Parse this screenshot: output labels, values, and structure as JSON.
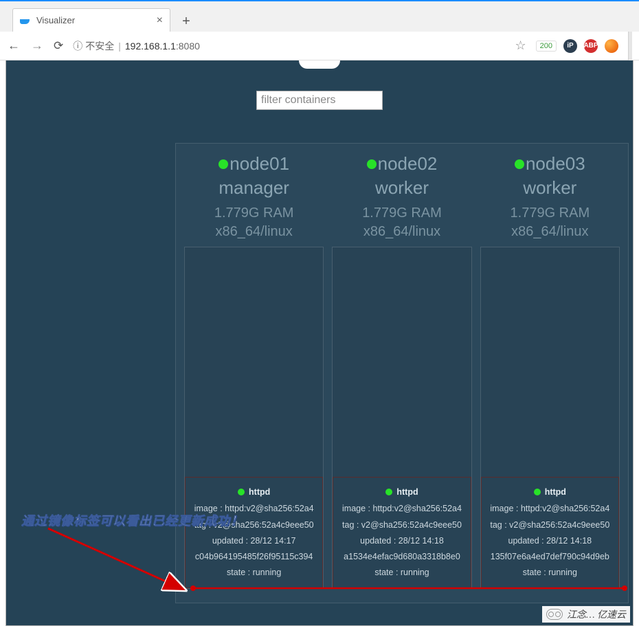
{
  "browser": {
    "tab": {
      "title": "Visualizer",
      "icon": "docker-whale-icon"
    },
    "nav": {
      "back_enabled": true,
      "forward_enabled": false
    },
    "address": {
      "insecure_label": "不安全",
      "host": "192.168.1.1",
      "port": "8080"
    },
    "ext_badge": "200"
  },
  "app": {
    "filter_placeholder": "filter containers",
    "nodes": [
      {
        "name": "node01",
        "role": "manager",
        "ram": "1.779G RAM",
        "arch": "x86_64/linux",
        "container": {
          "name": "httpd",
          "image": "image : httpd:v2@sha256:52a4",
          "tag": "tag : v2@sha256:52a4c9eee50",
          "updated": "updated : 28/12 14:17",
          "id": "c04b964195485f26f95115c394",
          "state": "state : running"
        }
      },
      {
        "name": "node02",
        "role": "worker",
        "ram": "1.779G RAM",
        "arch": "x86_64/linux",
        "container": {
          "name": "httpd",
          "image": "image : httpd:v2@sha256:52a4",
          "tag": "tag : v2@sha256:52a4c9eee50",
          "updated": "updated : 28/12 14:18",
          "id": "a1534e4efac9d680a3318b8e0",
          "state": "state : running"
        }
      },
      {
        "name": "node03",
        "role": "worker",
        "ram": "1.779G RAM",
        "arch": "x86_64/linux",
        "container": {
          "name": "httpd",
          "image": "image : httpd:v2@sha256:52a4",
          "tag": "tag : v2@sha256:52a4c9eee50",
          "updated": "updated : 28/12 14:18",
          "id": "135f07e6a4ed7def790c94d9eb",
          "state": "state : running"
        }
      }
    ]
  },
  "annotation": {
    "text": "通过镜像标签可以看出已经更新成功！"
  },
  "watermark": {
    "text": "江念… 亿速云"
  }
}
